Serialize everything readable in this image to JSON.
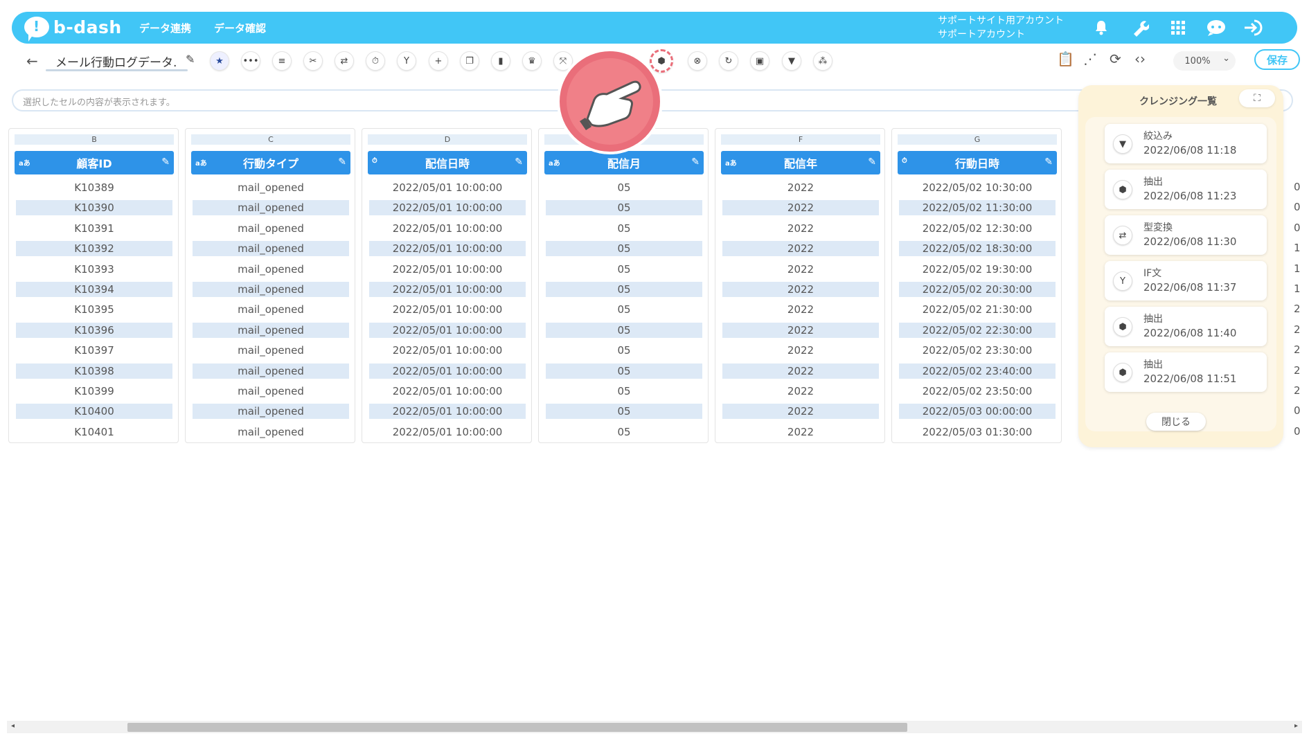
{
  "app": {
    "logo_text": "b-dash",
    "nav": [
      "データ連携",
      "データ確認"
    ]
  },
  "account": {
    "line1": "サポートサイト用アカウント",
    "line2": "サポートアカウント"
  },
  "toolbar": {
    "title": "メール行動ログデータ.",
    "zoom": "100%",
    "save_label": "保存"
  },
  "cellbar": {
    "placeholder": "選択したセルの内容が表示されます。"
  },
  "columns": [
    {
      "letter": "B",
      "type_icon": "aあ",
      "header": "顧客ID",
      "values": [
        "K10389",
        "K10390",
        "K10391",
        "K10392",
        "K10393",
        "K10394",
        "K10395",
        "K10396",
        "K10397",
        "K10398",
        "K10399",
        "K10400",
        "K10401"
      ]
    },
    {
      "letter": "C",
      "type_icon": "aあ",
      "header": "行動タイプ",
      "values": [
        "mail_opened",
        "mail_opened",
        "mail_opened",
        "mail_opened",
        "mail_opened",
        "mail_opened",
        "mail_opened",
        "mail_opened",
        "mail_opened",
        "mail_opened",
        "mail_opened",
        "mail_opened",
        "mail_opened"
      ]
    },
    {
      "letter": "D",
      "type_icon": "⏱",
      "header": "配信日時",
      "values": [
        "2022/05/01 10:00:00",
        "2022/05/01 10:00:00",
        "2022/05/01 10:00:00",
        "2022/05/01 10:00:00",
        "2022/05/01 10:00:00",
        "2022/05/01 10:00:00",
        "2022/05/01 10:00:00",
        "2022/05/01 10:00:00",
        "2022/05/01 10:00:00",
        "2022/05/01 10:00:00",
        "2022/05/01 10:00:00",
        "2022/05/01 10:00:00",
        "2022/05/01 10:00:00"
      ]
    },
    {
      "letter": "",
      "type_icon": "aあ",
      "header": "配信月",
      "values": [
        "05",
        "05",
        "05",
        "05",
        "05",
        "05",
        "05",
        "05",
        "05",
        "05",
        "05",
        "05",
        "05"
      ]
    },
    {
      "letter": "F",
      "type_icon": "aあ",
      "header": "配信年",
      "values": [
        "2022",
        "2022",
        "2022",
        "2022",
        "2022",
        "2022",
        "2022",
        "2022",
        "2022",
        "2022",
        "2022",
        "2022",
        "2022"
      ]
    },
    {
      "letter": "G",
      "type_icon": "⏱",
      "header": "行動日時",
      "values": [
        "2022/05/02 10:30:00",
        "2022/05/02 11:30:00",
        "2022/05/02 12:30:00",
        "2022/05/02 18:30:00",
        "2022/05/02 19:30:00",
        "2022/05/02 20:30:00",
        "2022/05/02 21:30:00",
        "2022/05/02 22:30:00",
        "2022/05/02 23:30:00",
        "2022/05/02 23:40:00",
        "2022/05/02 23:50:00",
        "2022/05/03 00:00:00",
        "2022/05/03 01:30:00"
      ]
    }
  ],
  "partial_column": {
    "values": [
      "0",
      "0",
      "0",
      "1",
      "1",
      "1",
      "2",
      "2",
      "2",
      "2",
      "2",
      "0",
      "0"
    ]
  },
  "cleansing": {
    "title": "クレンジング一覧",
    "close_label": "閉じる",
    "items": [
      {
        "name": "絞込み",
        "time": "2022/06/08 11:18",
        "icon": "filter-icon"
      },
      {
        "name": "抽出",
        "time": "2022/06/08 11:23",
        "icon": "extract-icon"
      },
      {
        "name": "型変換",
        "time": "2022/06/08 11:30",
        "icon": "type-convert-icon"
      },
      {
        "name": "IF文",
        "time": "2022/06/08 11:37",
        "icon": "branch-icon"
      },
      {
        "name": "抽出",
        "time": "2022/06/08 11:40",
        "icon": "extract-icon"
      },
      {
        "name": "抽出",
        "time": "2022/06/08 11:51",
        "icon": "extract-icon"
      }
    ]
  },
  "colors": {
    "brand": "#41c6f6",
    "header": "#2e93e8",
    "alt_row": "#dde9f6",
    "panel": "#fdf3d9",
    "highlight": "#ea6e7a"
  }
}
